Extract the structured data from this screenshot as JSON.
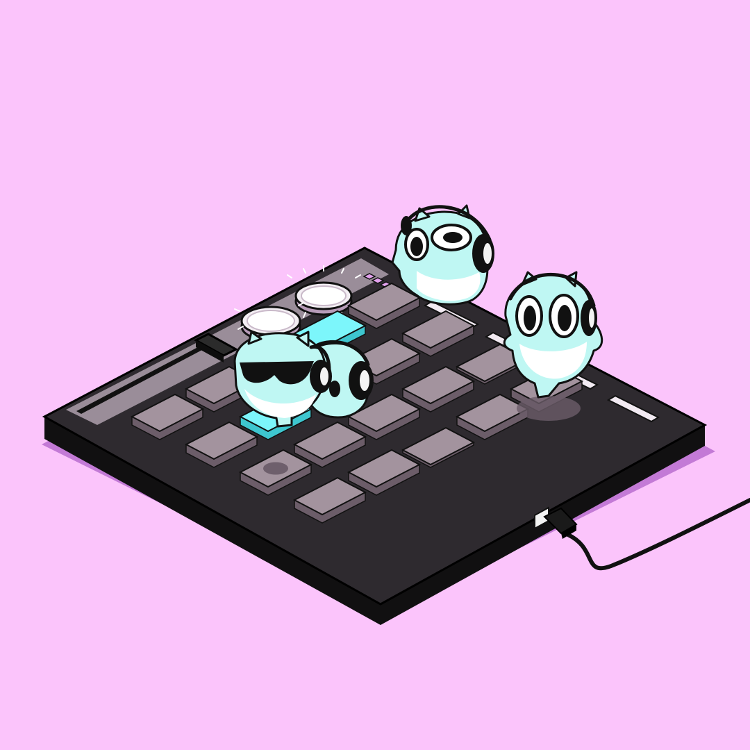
{
  "scene": {
    "background": "#fbc4fb",
    "shadow": "#c37ad6",
    "device": {
      "pad_rows": 4,
      "pad_cols": 5,
      "body_top": "#2e2a2f",
      "body_side": "#111011",
      "panel": "#9a8d99",
      "pad_idle": "#a3939e",
      "pad_idle_side": "#6c5d69",
      "pad_lit": "#7cf6fb",
      "pad_lit_side": "#3ec6cf",
      "lit_pads": [
        [
          1,
          1
        ],
        [
          1,
          2
        ],
        [
          0,
          2
        ],
        [
          0,
          3
        ]
      ],
      "pressed_pads": [
        [
          3,
          2
        ],
        [
          2,
          4
        ]
      ],
      "spot_pads": [
        [
          2,
          0
        ],
        [
          3,
          4
        ]
      ],
      "knob_color": "#f3eef3",
      "led_color": "#e3a1ee",
      "port_color": "#f2f2f2"
    },
    "characters": [
      {
        "name": "headphone-character-surprised",
        "color": "#bff7f3",
        "accessory": "headphones"
      },
      {
        "name": "headphone-character-standing",
        "color": "#bff7f3",
        "accessory": "headphones"
      },
      {
        "name": "character-with-sunglasses",
        "color": "#bff7f3",
        "accessory": "sunglasses"
      },
      {
        "name": "headphone-character-hiding",
        "color": "#bff7f3",
        "accessory": "headphones"
      }
    ],
    "icons": [
      "usb-plug-icon"
    ]
  }
}
